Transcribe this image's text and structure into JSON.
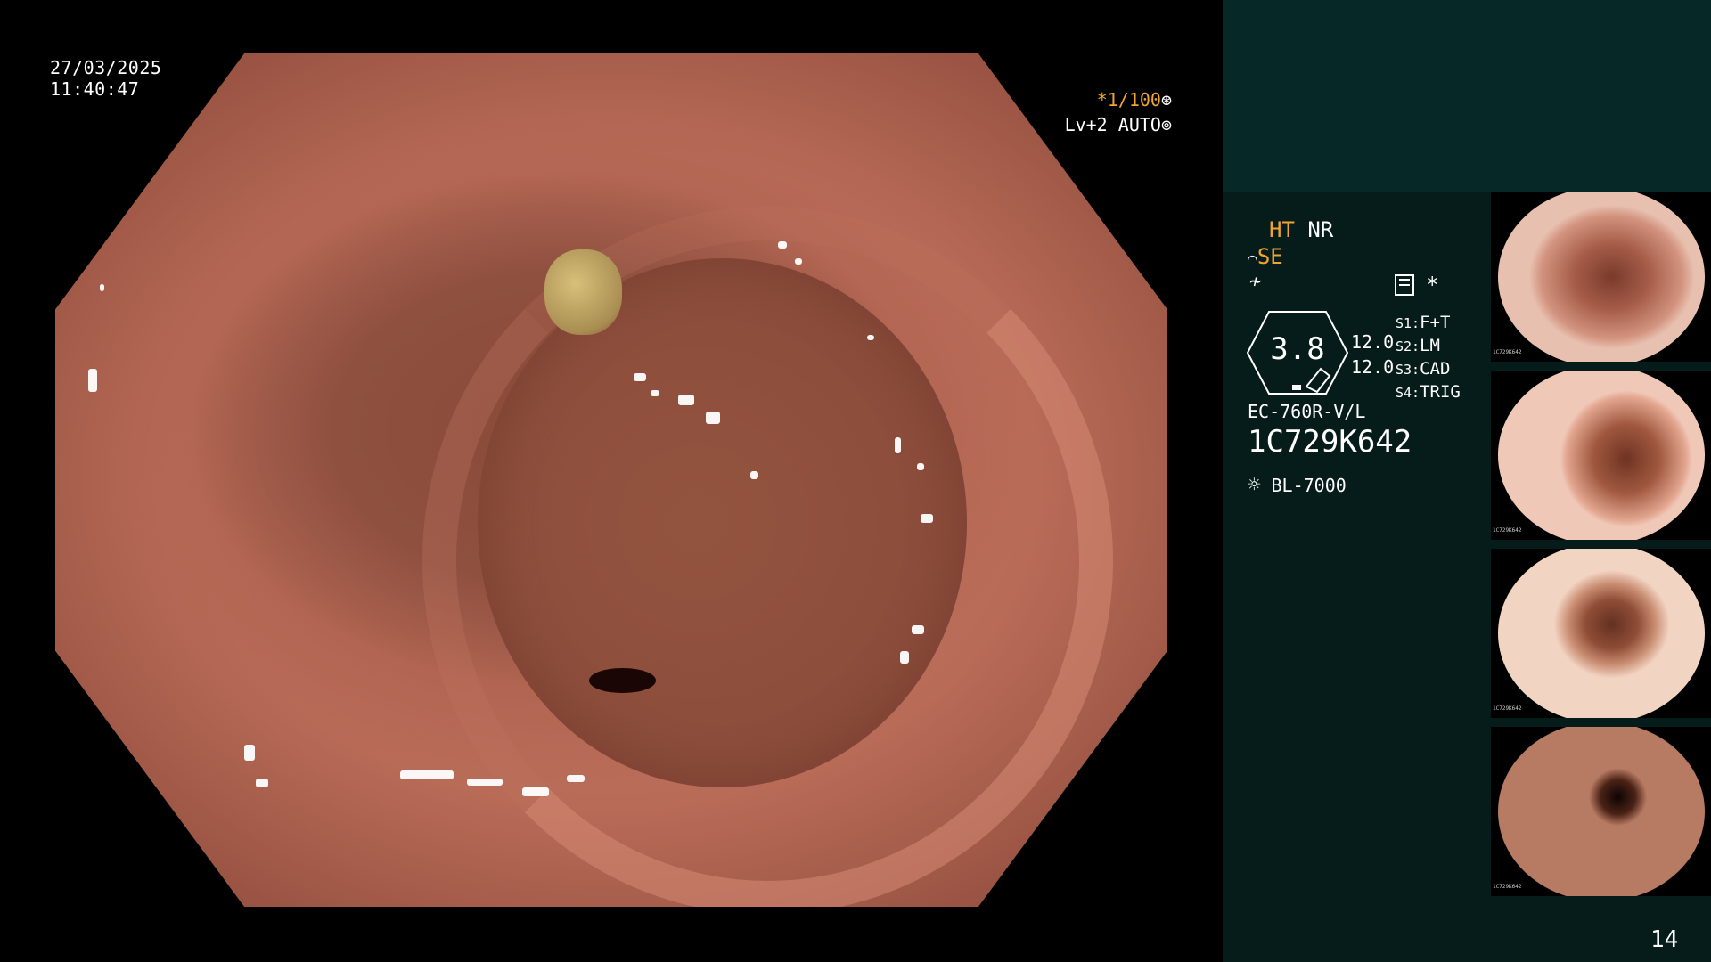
{
  "overlay": {
    "date": "27/03/2025",
    "time": "11:40:47",
    "shutter": "*1/100",
    "shutter_icon": "shutter-icon",
    "level": "Lv+2",
    "auto": "AUTO",
    "auto_icon": "iris-icon"
  },
  "panel": {
    "ht": "HT",
    "nr": "NR",
    "se": "SE",
    "se_icon": "enhance-icon",
    "filter_icon": "filter-icon",
    "memo_icon": "memo-icon",
    "asterisk": "*",
    "zoom_value": "3.8",
    "param_1": "12.0",
    "param_2": "12.0",
    "switches": [
      {
        "key": "S1:",
        "value": "F+T"
      },
      {
        "key": "S2:",
        "value": "LM"
      },
      {
        "key": "S3:",
        "value": "CAD"
      },
      {
        "key": "S4:",
        "value": "TRIG"
      }
    ],
    "scope_model": "EC-760R-V/L",
    "serial": "1C729K642",
    "light_source": "BL-7000",
    "light_icon": "light-source-icon",
    "image_count": "14"
  },
  "thumbnails": [
    {
      "serial": "1C729K642"
    },
    {
      "serial": "1C729K642"
    },
    {
      "serial": "1C729K642"
    },
    {
      "serial": "1C729K642"
    }
  ],
  "colors": {
    "accent_orange": "#f0a533",
    "panel_bg": "#061c1a",
    "panel_top_bg": "#062826"
  }
}
